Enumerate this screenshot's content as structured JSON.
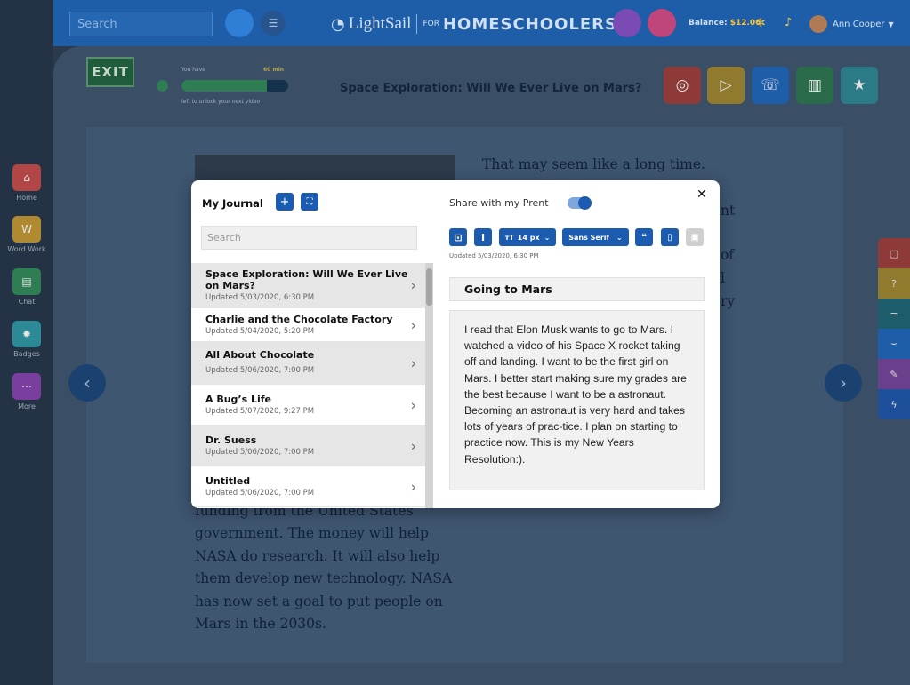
{
  "topbar": {
    "search_placeholder": "Search",
    "brand": "LightSail",
    "brand_for": "FOR",
    "brand_suffix": "HOMESCHOOLERS",
    "balance_label": "Balance:",
    "balance_value": "$12.06",
    "user_name": "Ann Cooper"
  },
  "sidebar": {
    "items": [
      {
        "label": "Home",
        "icon": "home-icon",
        "color": "#b24545"
      },
      {
        "label": "Word Work",
        "icon": "word-work-icon",
        "color": "#b08a30"
      },
      {
        "label": "Chat",
        "icon": "chat-icon",
        "color": "#2f7d52"
      },
      {
        "label": "Badges",
        "icon": "badge-icon",
        "color": "#2b8a96"
      },
      {
        "label": "More",
        "icon": "more-icon",
        "color": "#7a3f9e"
      }
    ]
  },
  "reader": {
    "exit_label": "EXIT",
    "progress_top": "You have",
    "progress_minutes": "60 min",
    "progress_bottom": "left to unlock your next video",
    "progress_fraction": 0.8,
    "book_title": "Space Exploration: Will We Ever Live on Mars?",
    "right_text": [
      "That may seem like a long time."
    ],
    "left_text": "funding from the United States government. The money will help NASA do research. It will also help them develop new technology. NASA has now set a goal to put people on Mars in the 2030s.",
    "partial_right": [
      "nt",
      "of",
      "l",
      "ry"
    ]
  },
  "journal": {
    "title": "My Journal",
    "search_placeholder": "Search",
    "share_label": "Share with my Prent",
    "share_enabled": true,
    "font_size": "14 px",
    "font_family": "Sans Serif",
    "updated_label": "Updated 5/03/2020, 6:30 PM",
    "entry_title": "Going to Mars",
    "entry_body": "I read that Elon Musk wants to go to Mars. I watched a video of his Space X rocket taking off and landing.  I want to be the first girl on Mars. I better start making sure my grades are the best because I want to be a astronaut. Becoming an astronaut is very hard and takes lots of years of prac-tice. I plan on starting to practice now. This is my New Years Resolution:).",
    "entries": [
      {
        "title": "Space Exploration: Will We Ever Live on Mars?",
        "updated": "Updated 5/03/2020, 6:30 PM"
      },
      {
        "title": "Charlie and the Chocolate Factory",
        "updated": "Updated 5/04/2020, 5:20 PM"
      },
      {
        "title": "All About Chocolate",
        "updated": "Updated 5/06/2020, 7:00 PM"
      },
      {
        "title": "A Bug’s Life",
        "updated": "Updated 5/07/2020, 9:27 PM"
      },
      {
        "title": "Dr. Suess",
        "updated": "Updated 5/06/2020, 7:00 PM"
      },
      {
        "title": "Untitled",
        "updated": "Updated 5/06/2020, 7:00 PM"
      }
    ]
  }
}
